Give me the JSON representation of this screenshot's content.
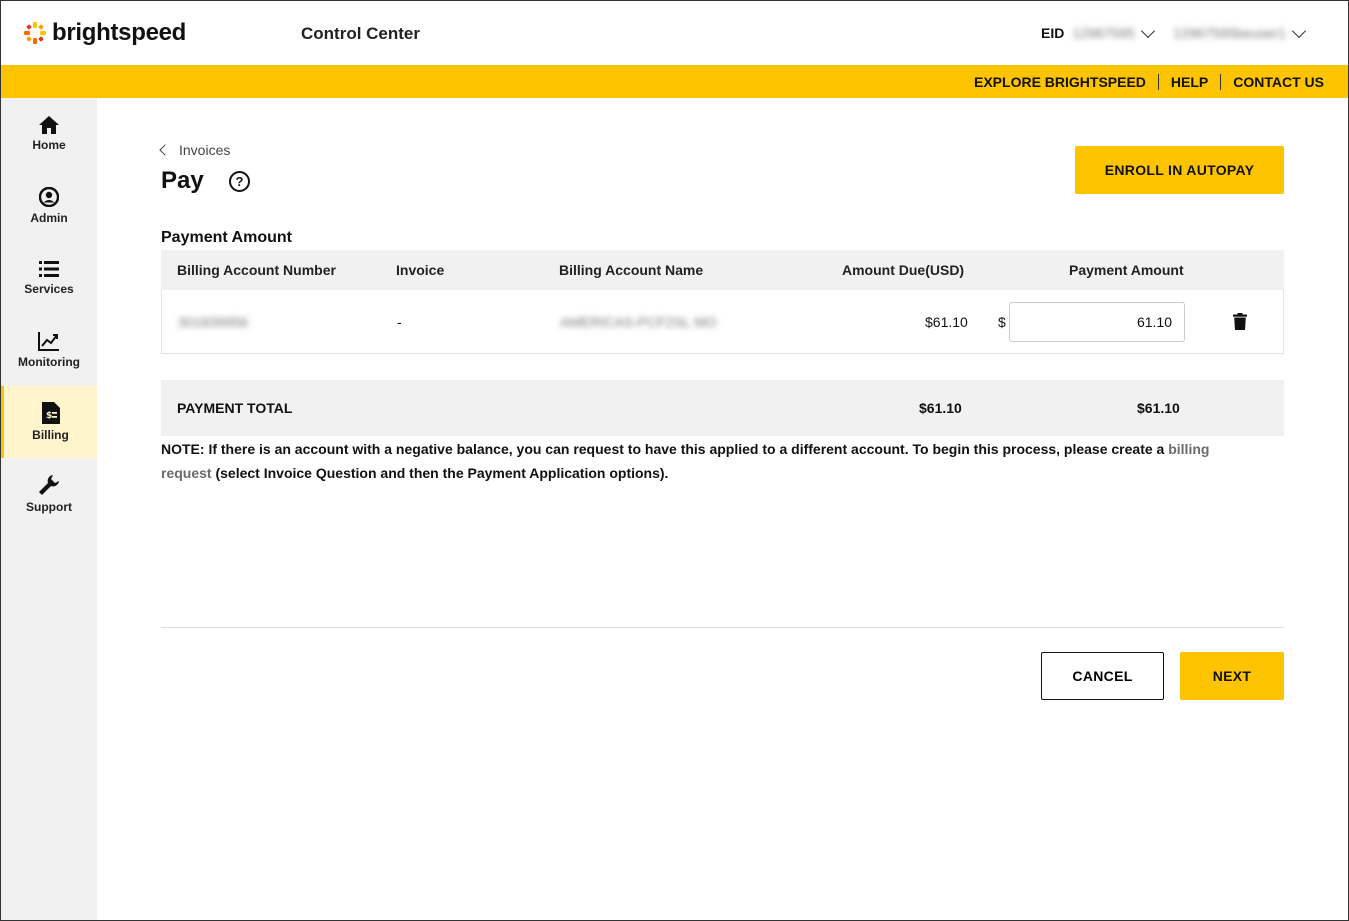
{
  "header": {
    "brand": "brightspeed",
    "app_title": "Control Center",
    "eid_label": "EID",
    "eid_value": "12967595",
    "user_name": "12967595beuser1"
  },
  "topbar": {
    "links": [
      "EXPLORE BRIGHTSPEED",
      "HELP",
      "CONTACT US"
    ]
  },
  "sidebar": {
    "items": [
      {
        "label": "Home",
        "icon": "home-icon"
      },
      {
        "label": "Admin",
        "icon": "user-circle-icon"
      },
      {
        "label": "Services",
        "icon": "list-icon"
      },
      {
        "label": "Monitoring",
        "icon": "chart-line-icon"
      },
      {
        "label": "Billing",
        "icon": "invoice-dollar-icon",
        "active": true
      },
      {
        "label": "Support",
        "icon": "wrench-icon"
      }
    ]
  },
  "page": {
    "breadcrumb": "Invoices",
    "title": "Pay",
    "help_symbol": "?",
    "enroll_label": "ENROLL IN AUTOPAY"
  },
  "payment": {
    "section_title": "Payment Amount",
    "columns": [
      "Billing Account Number",
      "Invoice",
      "Billing Account Name",
      "Amount Due(USD)",
      "Payment Amount"
    ],
    "rows": [
      {
        "account_number": "301839956",
        "invoice": "-",
        "account_name": "AMERICAS-PCF2SL MO",
        "amount_due": "$61.10",
        "currency_symbol": "$",
        "payment_amount": "61.10"
      }
    ],
    "total_label": "PAYMENT TOTAL",
    "total_due": "$61.10",
    "total_payment": "$61.10"
  },
  "note": {
    "text_before": "NOTE: If there is an account with a negative balance, you can request to have this applied to a different account. To begin this process, please create a ",
    "link_text": "billing request",
    "text_after": " (select Invoice Question and then the Payment Application options)."
  },
  "actions": {
    "cancel_label": "CANCEL",
    "next_label": "NEXT"
  },
  "colors": {
    "brand_yellow": "#ffc400",
    "sidebar_bg": "#f1f1f1",
    "active_nav_bg": "#fff4cc"
  }
}
